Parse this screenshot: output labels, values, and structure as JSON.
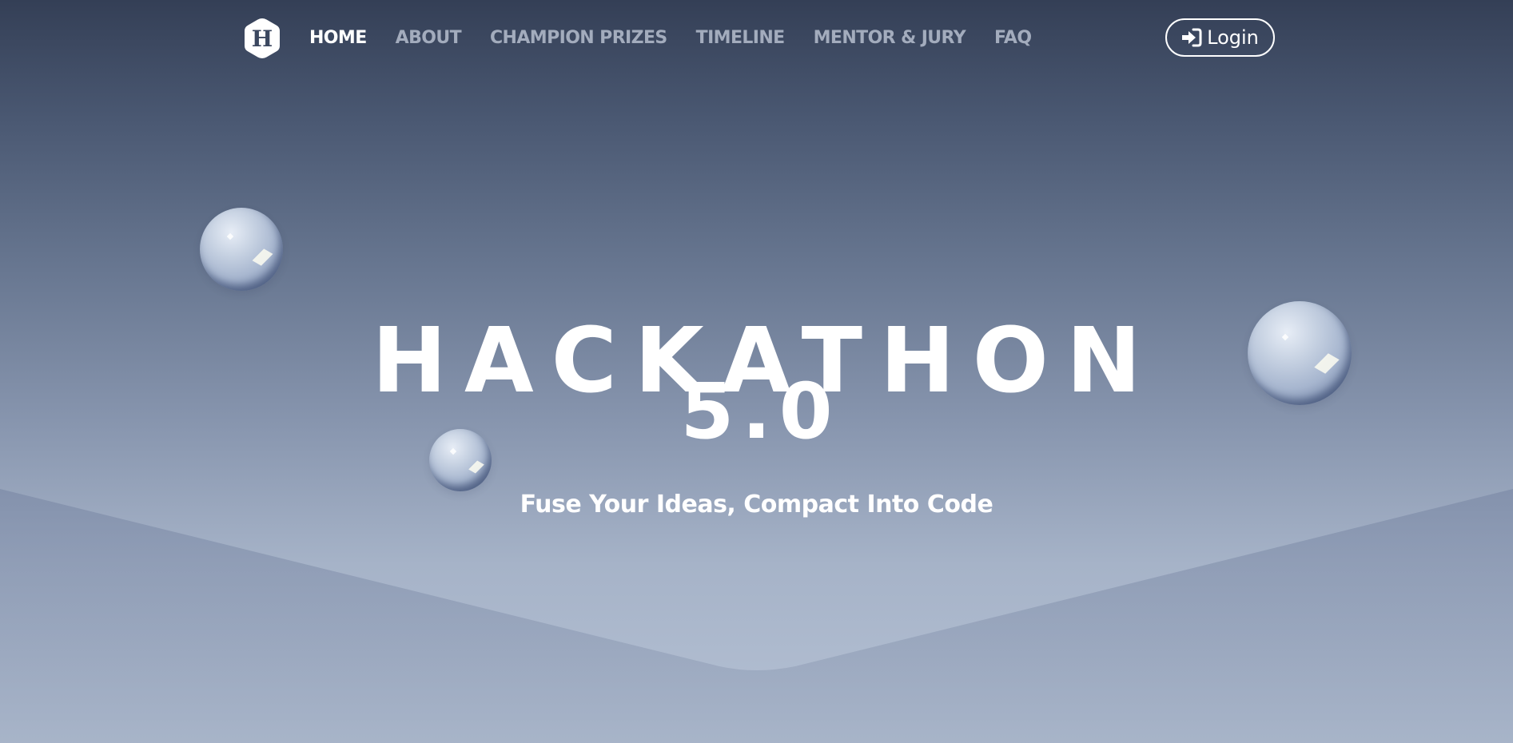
{
  "logo": {
    "letter": "H"
  },
  "nav": {
    "items": [
      {
        "label": "HOME",
        "active": true
      },
      {
        "label": "ABOUT",
        "active": false
      },
      {
        "label": "CHAMPION PRIZES",
        "active": false
      },
      {
        "label": "TIMELINE",
        "active": false
      },
      {
        "label": "MENTOR & JURY",
        "active": false
      },
      {
        "label": "FAQ",
        "active": false
      }
    ],
    "login_label": "Login"
  },
  "hero": {
    "title": "HACKATHON",
    "version": "5.0",
    "tagline": "Fuse Your Ideas, Compact Into Code"
  },
  "theme": {
    "text_color": "#ffffff",
    "nav_inactive_color": "#a3acbd",
    "background_top": "#343f56",
    "background_bottom": "#b5c1d4"
  },
  "icons": {
    "logo": "hexagon-logo-icon",
    "login": "sign-in-icon",
    "decorations": [
      "glass-sphere-icon",
      "glass-sphere-icon",
      "glass-sphere-icon"
    ]
  }
}
